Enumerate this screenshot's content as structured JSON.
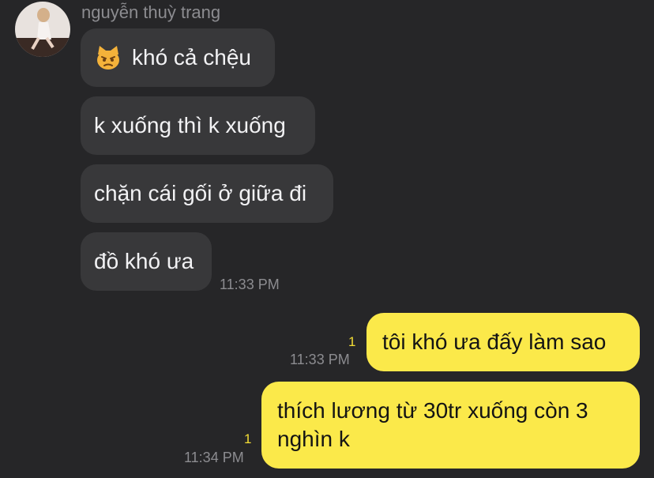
{
  "chat": {
    "sender_name": "nguyễn thuỳ trang",
    "incoming": [
      {
        "text": "khó cả chệu",
        "emoji": "pouting-cat-icon"
      },
      {
        "text": "k xuống thì k xuống"
      },
      {
        "text": "chặn cái gối ở giữa đi"
      },
      {
        "text": "đồ khó ưa"
      }
    ],
    "incoming_time": "11:33 PM",
    "outgoing": [
      {
        "text": "tôi khó ưa đấy làm sao",
        "time": "11:33 PM",
        "unread": "1"
      },
      {
        "text": "thích lương từ 30tr xuống còn 3 nghìn k",
        "time": "11:34 PM",
        "unread": "1"
      }
    ]
  },
  "colors": {
    "background": "#262628",
    "incoming_bubble": "#38383a",
    "outgoing_bubble": "#fbe94a",
    "unread_indicator": "#f2dc34"
  }
}
